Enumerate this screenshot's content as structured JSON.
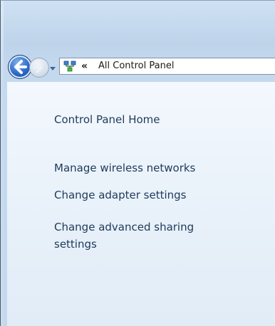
{
  "address_bar": {
    "chevron": "«",
    "path": "All Control Panel"
  },
  "nav_buttons": {
    "back_icon": "back-arrow-icon",
    "forward_icon": "forward-arrow-icon",
    "history_icon": "chevron-down-icon"
  },
  "nav_pane": {
    "home_link": "Control Panel Home",
    "links": [
      "Manage wireless networks",
      "Change adapter settings",
      "Change advanced sharing",
      "settings"
    ]
  },
  "colors": {
    "link": "#1e3a5a",
    "back_button": "#2c68c8",
    "frame": "#c5d9ee"
  }
}
